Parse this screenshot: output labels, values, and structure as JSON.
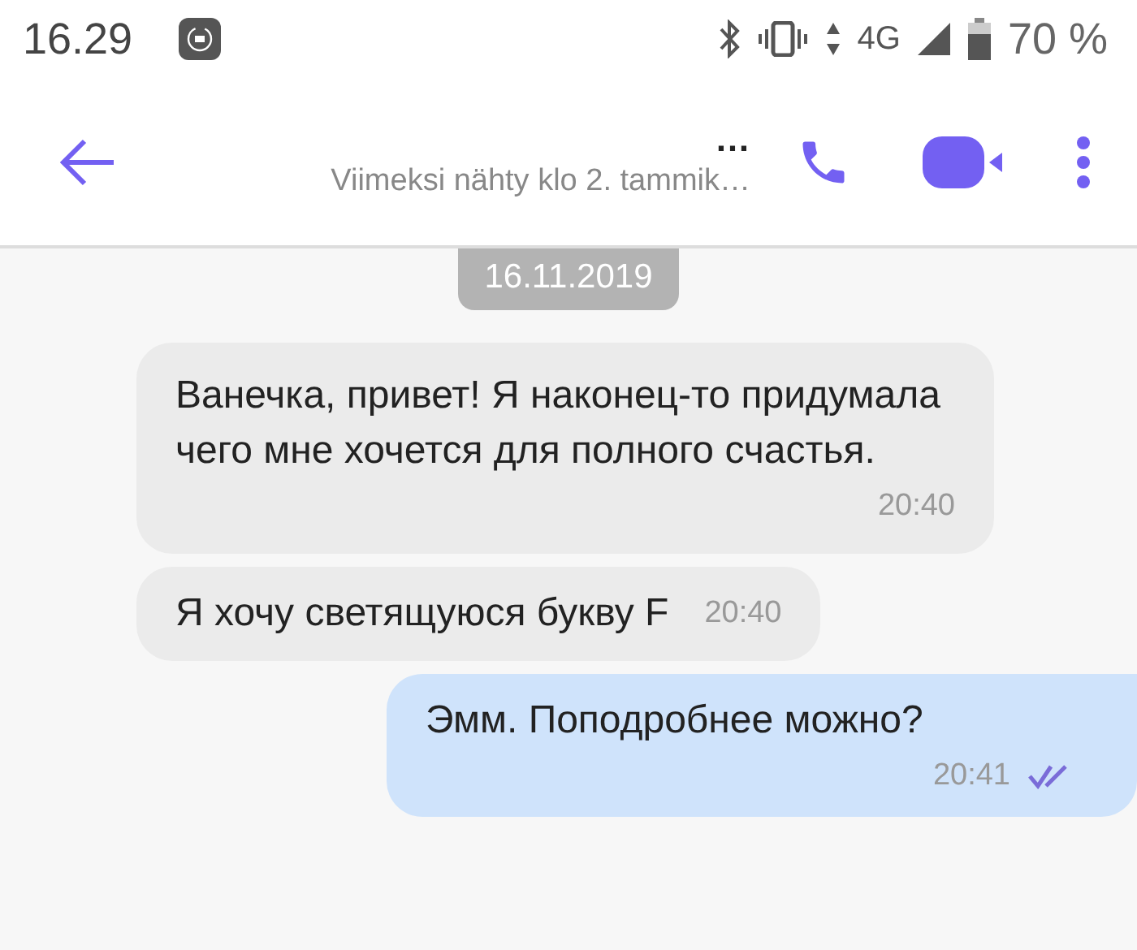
{
  "status_bar": {
    "time": "16.29",
    "network": "4G",
    "battery": "70 %"
  },
  "header": {
    "title": "…",
    "subtitle": "Viimeksi nähty klo 2. tammik…"
  },
  "date_separator": "16.11.2019",
  "messages": [
    {
      "kind": "incoming",
      "text": "Ванечка, привет! Я наконец-то придумала чего мне хочется для полного счастья.",
      "time": "20:40"
    },
    {
      "kind": "incoming",
      "text": "Я хочу светящуюся букву F",
      "time": "20:40"
    },
    {
      "kind": "outgoing",
      "text": "Эмм. Поподробнее можно?",
      "time": "20:41",
      "read": true
    }
  ]
}
